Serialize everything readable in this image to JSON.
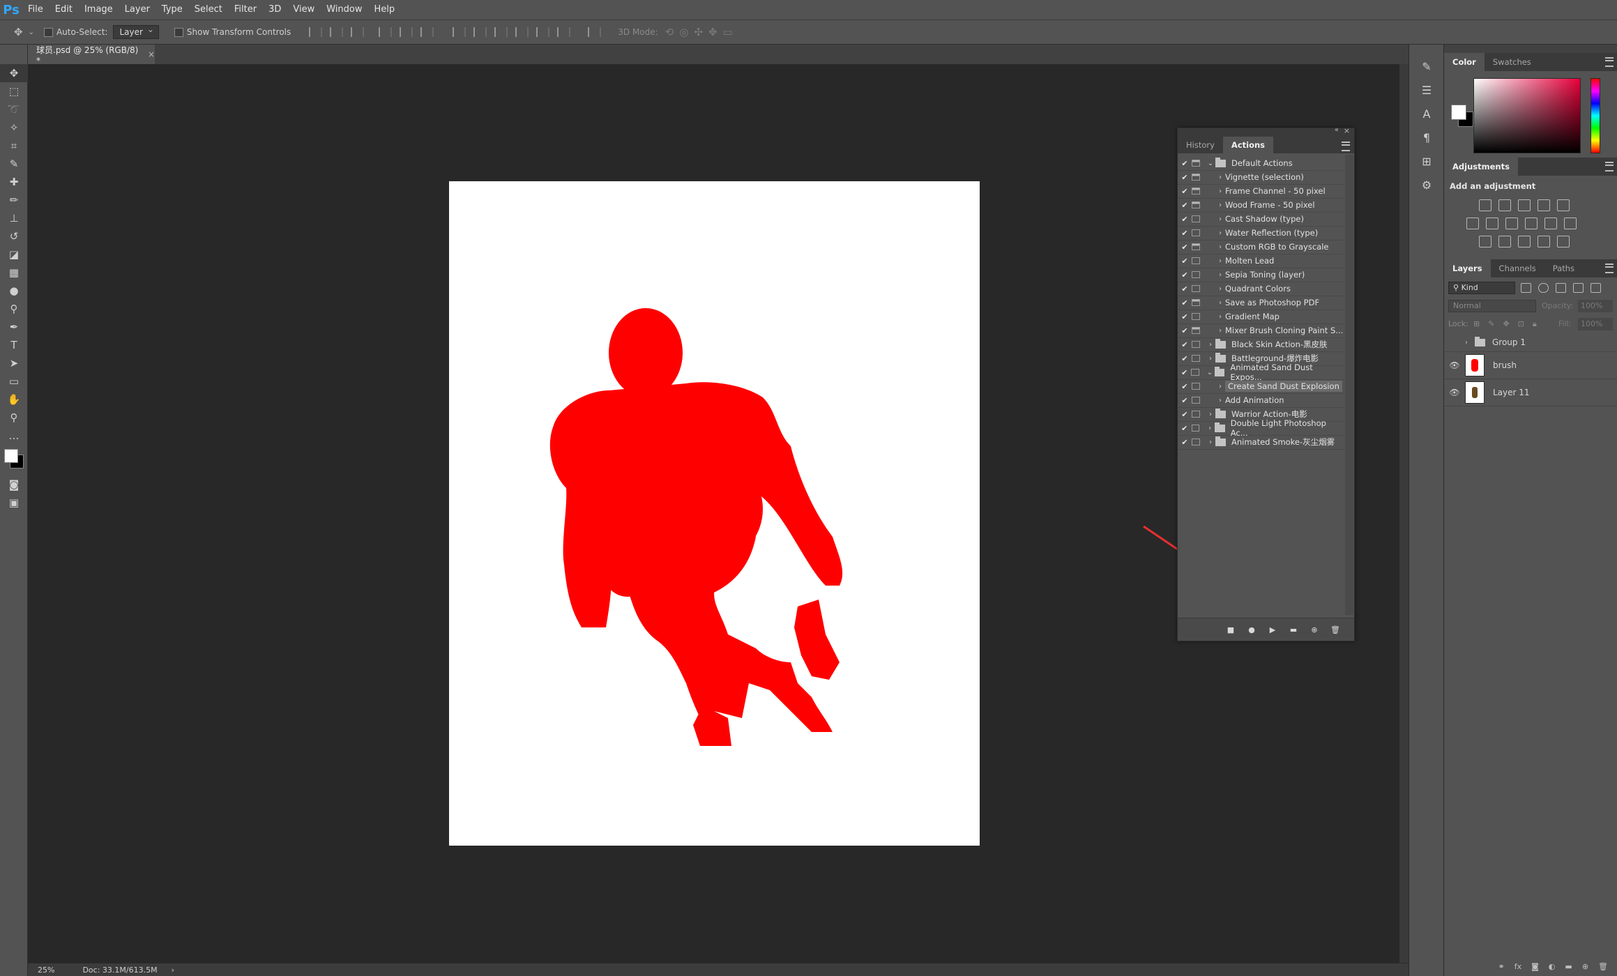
{
  "app": {
    "logo": "Ps"
  },
  "menu": [
    "File",
    "Edit",
    "Image",
    "Layer",
    "Type",
    "Select",
    "Filter",
    "3D",
    "View",
    "Window",
    "Help"
  ],
  "options": {
    "auto_select_label": "Auto-Select:",
    "auto_select_value": "Layer",
    "show_transform_label": "Show Transform Controls",
    "mode_3d_label": "3D Mode:"
  },
  "document": {
    "tab_title": "球员.psd @ 25% (RGB/8) *",
    "silhouette_color": "#ff0000"
  },
  "status": {
    "zoom": "25%",
    "doc": "Doc: 33.1M/613.5M"
  },
  "panels": {
    "color_tabs": [
      "Color",
      "Swatches"
    ],
    "adjustments_title": "Adjustments",
    "add_adjustment": "Add an adjustment",
    "layers_tabs": [
      "Layers",
      "Channels",
      "Paths"
    ],
    "kind_label": "Kind",
    "blend_mode": "Normal",
    "opacity_label": "Opacity:",
    "opacity_value": "100%",
    "lock_label": "Lock:",
    "fill_label": "Fill:",
    "fill_value": "100%",
    "layers": [
      {
        "name": "Group 1",
        "type": "group",
        "visible": false
      },
      {
        "name": "brush",
        "type": "layer",
        "visible": true
      },
      {
        "name": "Layer 11",
        "type": "layer",
        "visible": true
      }
    ]
  },
  "actions_panel": {
    "tabs": [
      "History",
      "Actions"
    ],
    "items": [
      {
        "label": "Default Actions",
        "kind": "set",
        "expanded": true,
        "dialog": true
      },
      {
        "label": "Vignette (selection)",
        "kind": "action",
        "dialog": true
      },
      {
        "label": "Frame Channel - 50 pixel",
        "kind": "action",
        "dialog": true
      },
      {
        "label": "Wood Frame - 50 pixel",
        "kind": "action",
        "dialog": true
      },
      {
        "label": "Cast Shadow (type)",
        "kind": "action",
        "dialog": false
      },
      {
        "label": "Water Reflection (type)",
        "kind": "action",
        "dialog": false
      },
      {
        "label": "Custom RGB to Grayscale",
        "kind": "action",
        "dialog": true
      },
      {
        "label": "Molten Lead",
        "kind": "action",
        "dialog": false
      },
      {
        "label": "Sepia Toning (layer)",
        "kind": "action",
        "dialog": false
      },
      {
        "label": "Quadrant Colors",
        "kind": "action",
        "dialog": false
      },
      {
        "label": "Save as Photoshop PDF",
        "kind": "action",
        "dialog": true
      },
      {
        "label": "Gradient Map",
        "kind": "action",
        "dialog": false
      },
      {
        "label": "Mixer Brush Cloning Paint S...",
        "kind": "action",
        "dialog": true
      },
      {
        "label": "Black Skin Action-黑皮肤",
        "kind": "set",
        "expanded": false,
        "dialog": false
      },
      {
        "label": "Battleground-爆炸电影",
        "kind": "set",
        "expanded": false,
        "dialog": false
      },
      {
        "label": "Animated Sand Dust Expos...",
        "kind": "set",
        "expanded": true,
        "dialog": false
      },
      {
        "label": "Create Sand Dust Explosion",
        "kind": "action",
        "dialog": false,
        "selected": true
      },
      {
        "label": "Add Animation",
        "kind": "action",
        "dialog": false
      },
      {
        "label": "Warrior Action-电影",
        "kind": "set",
        "expanded": false,
        "dialog": false
      },
      {
        "label": "Double Light Photoshop Ac...",
        "kind": "set",
        "expanded": false,
        "dialog": false
      },
      {
        "label": "Animated Smoke-灰尘烟雾",
        "kind": "set",
        "expanded": false,
        "dialog": false
      }
    ],
    "buttons": [
      "stop",
      "record",
      "play",
      "new-set",
      "new-action",
      "delete"
    ]
  },
  "colors": {
    "arrow": "#e53030",
    "accent": "#31a8ff"
  }
}
